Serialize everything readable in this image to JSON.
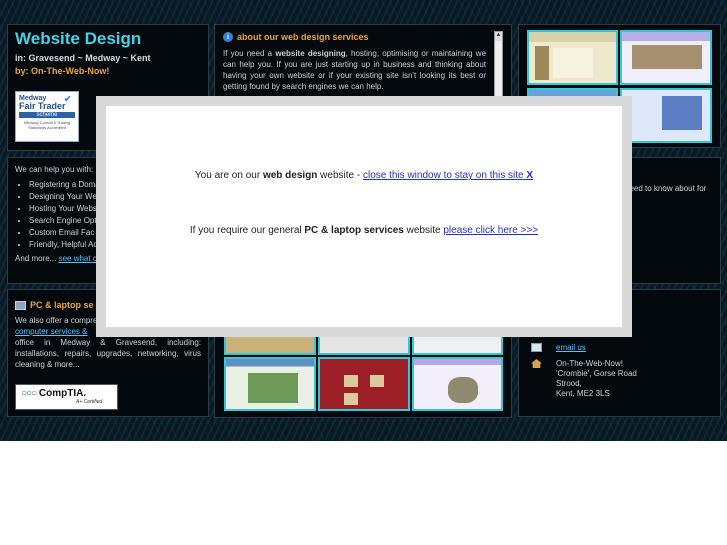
{
  "header": {
    "title": "Website Design",
    "subtitle": "in: Gravesend ~ Medway ~ Kent",
    "by": "by: On-The-Web-Now!",
    "badge": {
      "line1": "Medway",
      "line2": "Fair Trader",
      "line3": "scheme",
      "line4": "Medway Council's Trading Standards Accredited"
    }
  },
  "about": {
    "title": "about our web design services",
    "text_pre": "If you need a ",
    "text_bold": "website designing",
    "text_post": ", hosting, optimising or maintaining we can help you. If you are just starting up in business and thinking about having your own website or if your existing site isn't looking its best or getting found by search engines we can help."
  },
  "help": {
    "intro": "We can help you with:",
    "items": [
      "Registering a Domain",
      "Designing Your We",
      "Hosting Your Websi",
      "Search Engine Opt",
      "Custom Email Fac",
      "Friendly, Helpful Ad"
    ],
    "more_prefix": "And more... ",
    "more_link": "see what c"
  },
  "info": {
    "text": "need to know about for"
  },
  "pc": {
    "title": "PC & laptop se",
    "text_pre": "We also offer a compre",
    "link": "computer services &",
    "text_post": "office in Medway & Gravesend, including: installations, repairs, upgrades, networking, virus cleaning & more...",
    "badge": "CompTIA.",
    "badge_cert": "A+ Certified"
  },
  "contact": {
    "email": "email us",
    "address": [
      "On-The-Web-Now!",
      "'Crombie', Gorse Road",
      "Strood,",
      "Kent, ME2 3LS"
    ]
  },
  "modal": {
    "l1_pre": "You are on our ",
    "l1_bold": "web design",
    "l1_mid": " website - ",
    "l1_link": "close this window to stay on this site ",
    "l1_x": "X",
    "l2_pre": "If you require our general ",
    "l2_bold": "PC & laptop services",
    "l2_mid": " website ",
    "l2_link": "please click here >>>"
  },
  "colors": {
    "accent_cyan": "#45d4e6",
    "accent_orange": "#e8a534",
    "link": "#4fc6ff",
    "background_dark": "#0b1822"
  }
}
